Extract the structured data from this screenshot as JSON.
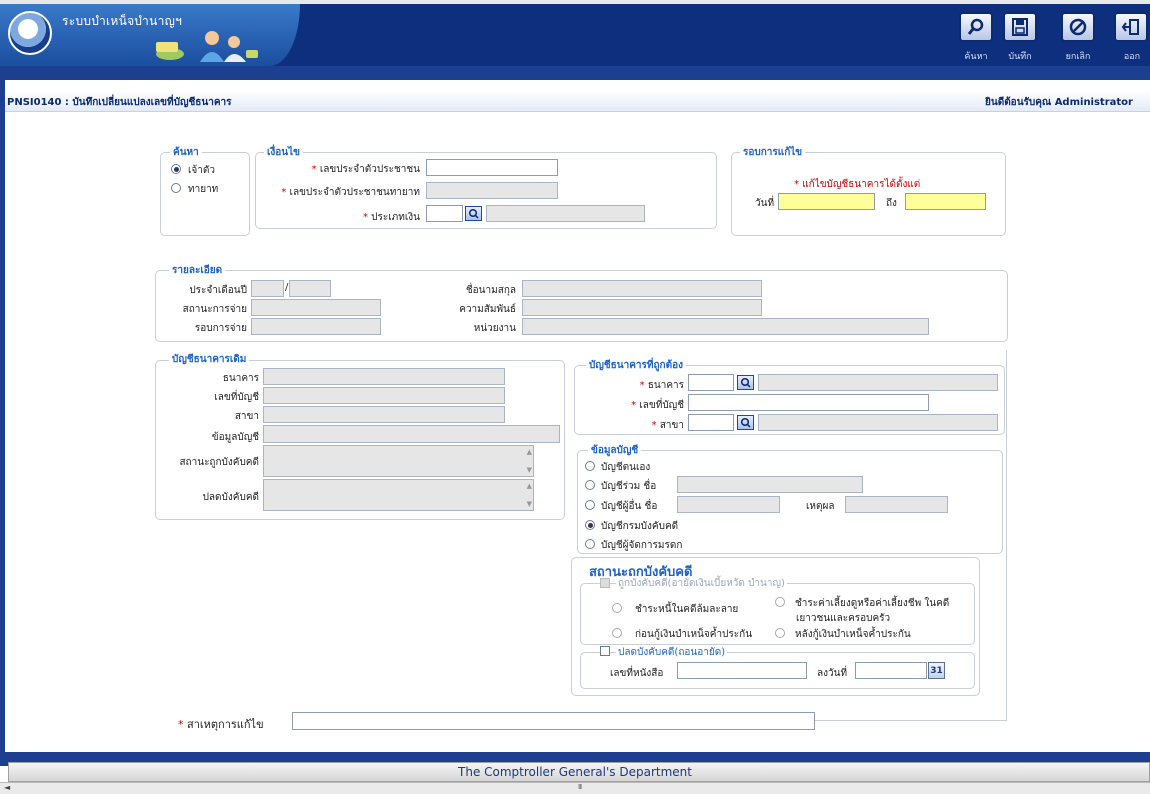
{
  "header": {
    "app_title": "ระบบบำเหน็จบำนาญฯ",
    "toolbar": [
      {
        "icon": "search-icon",
        "label": "ค้นหา"
      },
      {
        "icon": "save-icon",
        "label": "บันทึก"
      },
      {
        "icon": "cancel-icon",
        "label": "ยกเลิก"
      },
      {
        "icon": "exit-icon",
        "label": "ออก"
      }
    ]
  },
  "page": {
    "title": "PNSI0140 : บันทึกเปลี่ยนแปลงเลขที่บัญชีธนาคาร",
    "welcome": "ยินดีต้อนรับคุณ Administrator"
  },
  "search": {
    "legend": "ค้นหา",
    "opt1": "เจ้าตัว",
    "opt2": "ทายาท",
    "selected": "เจ้าตัว"
  },
  "condition": {
    "legend": "เงื่อนไข",
    "citizen_id": "เลขประจำตัวประชาชน",
    "heir_id": "เลขประจำตัวประชาชนทายาท",
    "money_type": "ประเภทเงิน"
  },
  "round": {
    "legend": "รอบการแก้ไข",
    "note": "แก้ไขบัญชีธนาคารได้ตั้งแต่",
    "date_label": "วันที่",
    "to_label": "ถึง"
  },
  "detail": {
    "legend": "รายละเอียด",
    "month_year": "ประจำเดือนปี",
    "sep": "/",
    "pay_status": "สถานะการจ่าย",
    "pay_round": "รอบการจ่าย",
    "name": "ชื่อนามสกุล",
    "relation": "ความสัมพันธ์",
    "unit": "หน่วยงาน"
  },
  "old_account": {
    "legend": "บัญชีธนาคารเดิม",
    "bank": "ธนาคาร",
    "account_no": "เลขที่บัญชี",
    "branch": "สาขา",
    "info": "ข้อมูลบัญชี",
    "seized": "สถานะถูกบังคับคดี",
    "released": "ปลดบังคับคดี"
  },
  "new_account": {
    "legend": "บัญชีธนาคารที่ถูกต้อง",
    "bank": "ธนาคาร",
    "account_no": "เลขที่บัญชี",
    "branch": "สาขา"
  },
  "account_info": {
    "legend": "ข้อมูลบัญชี",
    "own": "บัญชีตนเอง",
    "joint": "บัญชีร่วม ชื่อ",
    "other": "บัญชีผู้อื่น ชื่อ",
    "reason": "เหตุผล",
    "enforcement": "บัญชีกรมบังคับคดี",
    "estate": "บัญชีผู้จัดการมรดก",
    "selected": "บัญชีกรมบังคับคดี"
  },
  "enforce": {
    "title": "สถานะถูกบังคับคดี",
    "seized_group": "ถูกบังคับคดี(อายัดเงินเบี้ยหวัด บำนาญ)",
    "opt_bankrupt": "ชำระหนี้ในคดีล้มละลาย",
    "opt_alimony_1": "ชำระค่าเลี้ยงดูหรือค่าเลี้ยงชีพ ในคดี",
    "opt_alimony_2": "เยาวชนและครอบครัว",
    "opt_before": "ก่อนกู้เงินบำเหน็จค้ำประกัน",
    "opt_after": "หลังกู้เงินบำเหน็จค้ำประกัน",
    "release_group": "ปลดบังคับคดี(ถอนอายัด)",
    "letter_no": "เลขที่หนังสือ",
    "sign_date": "ลงวันที่",
    "cal": "31"
  },
  "reason": {
    "label": "สาเหตุการแก้ไข"
  },
  "footer": {
    "text": "The Comptroller General's Department",
    "scroll_mark": "III"
  },
  "colors": {
    "header_bg": "#0d2f7e",
    "legend": "#1d63c3",
    "required": "#d10000",
    "highlight": "#ffff99"
  }
}
